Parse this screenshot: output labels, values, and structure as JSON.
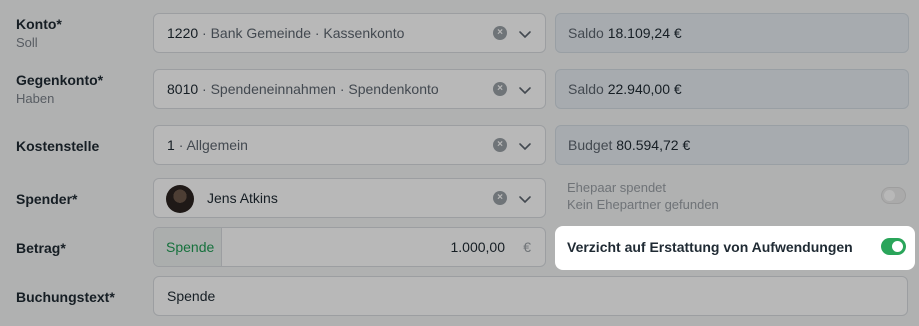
{
  "konto": {
    "label": "Konto*",
    "sublabel": "Soll",
    "number": "1220",
    "detail": "· Bank Gemeinde · Kassenkonto",
    "saldo_label": "Saldo",
    "saldo_value": "18.109,24 €"
  },
  "gegenkonto": {
    "label": "Gegenkonto*",
    "sublabel": "Haben",
    "number": "8010",
    "detail": "· Spendeneinnahmen · Spendenkonto",
    "saldo_label": "Saldo",
    "saldo_value": "22.940,00 €"
  },
  "kostenstelle": {
    "label": "Kostenstelle",
    "number": "1",
    "detail": "· Allgemein",
    "budget_label": "Budget",
    "budget_value": "80.594,72 €"
  },
  "spender": {
    "label": "Spender*",
    "name": "Jens Atkins",
    "ehepaar_label": "Ehepaar spendet",
    "ehepaar_hint": "Kein Ehepartner gefunden",
    "ehepaar_enabled": false
  },
  "betrag": {
    "label": "Betrag*",
    "type": "Spende",
    "amount": "1.000,00",
    "currency": "€"
  },
  "verzicht": {
    "label": "Verzicht auf Erstattung von Aufwendungen",
    "enabled": true
  },
  "buchungstext": {
    "label": "Buchungstext*",
    "value": "Spende"
  },
  "icons": {
    "clear": "x-circle-icon",
    "dropdown": "chevron-down-icon",
    "avatar": "user-avatar"
  },
  "colors": {
    "toggle_on": "#2aa55a",
    "spende_text": "#1f9d55"
  }
}
